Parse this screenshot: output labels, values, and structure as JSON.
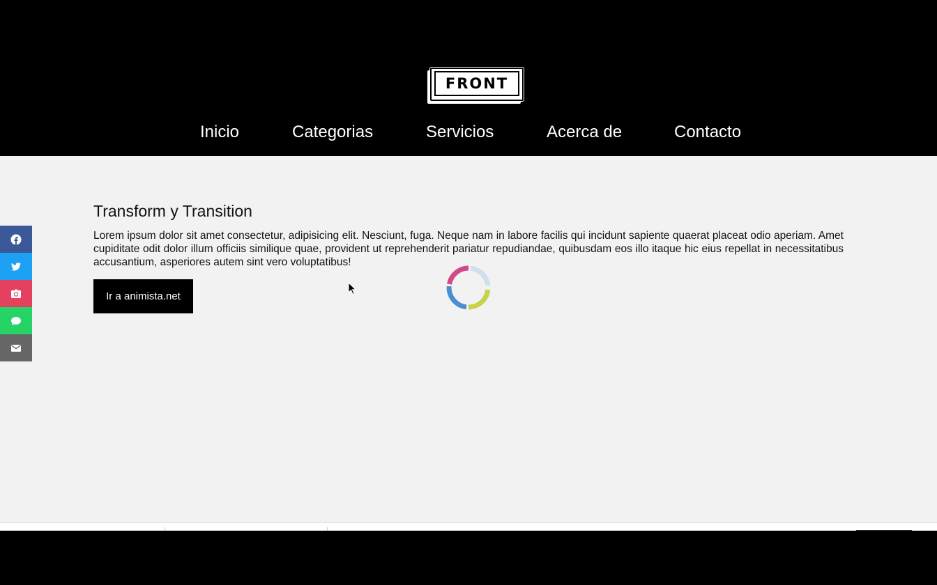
{
  "logo": {
    "text": "FRONT"
  },
  "nav": {
    "items": [
      {
        "label": "Inicio"
      },
      {
        "label": "Categorias"
      },
      {
        "label": "Servicios"
      },
      {
        "label": "Acerca de"
      },
      {
        "label": "Contacto"
      }
    ]
  },
  "content": {
    "title": "Transform y Transition",
    "paragraph": "Lorem ipsum dolor sit amet consectetur, adipisicing elit. Nesciunt, fuga. Neque nam in labore facilis qui incidunt sapiente quaerat placeat odio aperiam. Amet cupiditate odit dolor illum officiis similique quae, provident ut reprehenderit pariatur repudiandae, quibusdam eos illo itaque hic eius repellat in necessitatibus accusantium, asperiores autem sint vero voluptatibus!",
    "button_label": "Ir a animista.net"
  },
  "social": {
    "items": [
      {
        "icon": "facebook-icon",
        "color": "#3b5998"
      },
      {
        "icon": "twitter-icon",
        "color": "#1da1f2"
      },
      {
        "icon": "camera-icon",
        "color": "#e4405f"
      },
      {
        "icon": "chat-icon",
        "color": "#25d366"
      },
      {
        "icon": "mail-icon",
        "color": "#666666"
      }
    ]
  },
  "loader": {
    "colors": [
      "#d04a87",
      "#cfe0ec",
      "#c8d24a",
      "#4a8fd0"
    ]
  },
  "colors": {
    "header_bg": "#000000",
    "main_bg": "#f2f2f2",
    "button_bg": "#000000"
  }
}
